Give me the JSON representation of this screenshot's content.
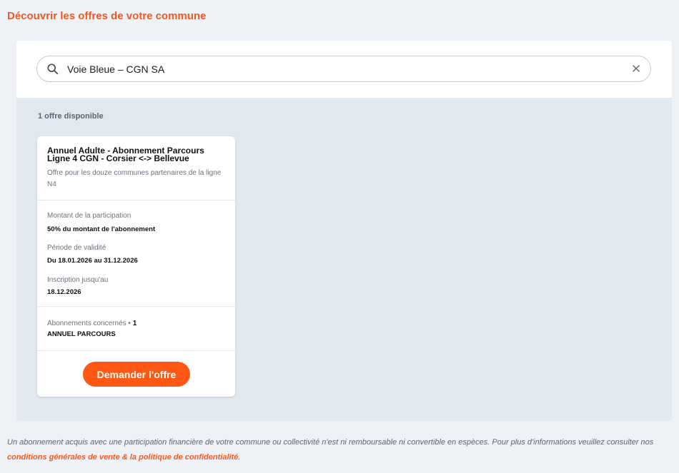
{
  "page": {
    "title": "Découvrir les offres de votre commune"
  },
  "search": {
    "value": "Voie Bleue – CGN SA",
    "placeholder": ""
  },
  "results": {
    "count_label": "1 offre disponible"
  },
  "offer": {
    "title": "Annuel Adulte - Abonnement Parcours Ligne 4 CGN - Corsier <-> Bellevue",
    "description": "Offre pour les douze communes partenaires de la ligne N4",
    "participation_label": "Montant de la participation",
    "participation_value": "50% du montant de l'abonnement",
    "validity_label": "Période de validité",
    "validity_value": "Du 18.01.2026 au 31.12.2026",
    "deadline_label": "Inscription jusqu'au",
    "deadline_value": "18.12.2026",
    "subscriptions_label": "Abonnements concernés",
    "subscriptions_separator": " • ",
    "subscriptions_count": "1",
    "subscription_name": "ANNUEL PARCOURS",
    "cta_label": "Demander l'offre"
  },
  "footer": {
    "text": "Un abonnement acquis avec une participation financière de votre commune ou collectivité n'est ni remboursable ni convertible en espèces. Pour plus d'informations veuillez consulter nos ",
    "link_text": "conditions générales de vente & la politique de confidentialité",
    "end": "."
  },
  "colors": {
    "accent": "#f05a22",
    "button": "#ff5714",
    "background": "#eef2f6",
    "panel": "#e2e8ef"
  },
  "icons": {
    "search": "search-icon",
    "clear": "close-icon"
  }
}
